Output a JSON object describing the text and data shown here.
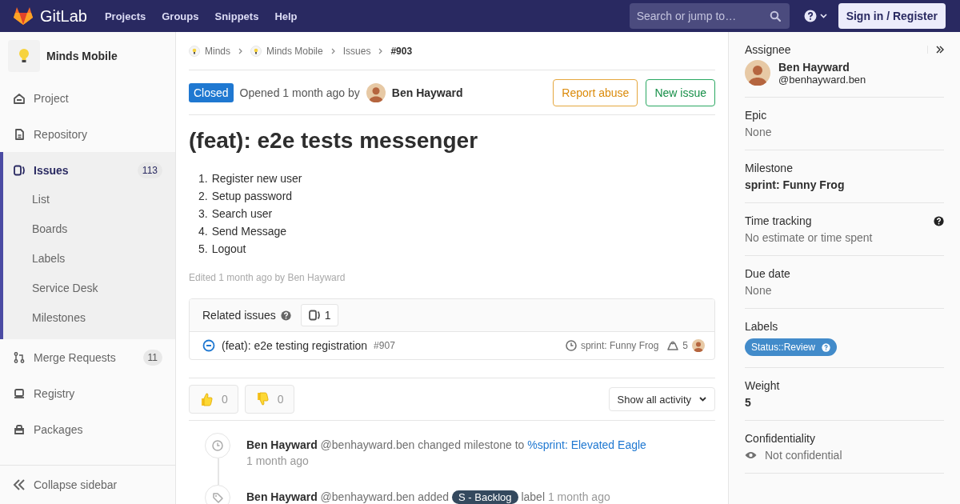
{
  "topbar": {
    "logo": "GitLab",
    "nav": [
      {
        "label": "Projects"
      },
      {
        "label": "Groups"
      },
      {
        "label": "Snippets"
      },
      {
        "label": "Help"
      }
    ],
    "search": {
      "placeholder": "Search or jump to…"
    },
    "sign_in": "Sign in / Register"
  },
  "sidebar": {
    "project": "Minds Mobile",
    "items": [
      {
        "label": "Project",
        "selected": false
      },
      {
        "label": "Repository",
        "selected": false
      },
      {
        "label": "Issues",
        "count": "113",
        "selected": true,
        "children": [
          {
            "label": "List"
          },
          {
            "label": "Boards"
          },
          {
            "label": "Labels"
          },
          {
            "label": "Service Desk"
          },
          {
            "label": "Milestones"
          }
        ]
      },
      {
        "label": "Merge Requests",
        "count": "11",
        "selected": false
      },
      {
        "label": "Registry",
        "selected": false
      },
      {
        "label": "Packages",
        "selected": false
      }
    ],
    "collapse": "Collapse sidebar"
  },
  "breadcrumbs": [
    {
      "label": "Minds",
      "current": false
    },
    {
      "label": "Minds Mobile",
      "current": false
    },
    {
      "label": "Issues",
      "current": false
    },
    {
      "label": "#903",
      "current": true
    }
  ],
  "issue": {
    "status": "Closed",
    "closed": true,
    "opened": "Opened 1 month ago by",
    "author": "Ben Hayward",
    "buttons": [
      {
        "label": "Report abuse",
        "kind": "warning"
      },
      {
        "label": "New issue",
        "kind": "success"
      }
    ],
    "title": "(feat): e2e tests messenger",
    "steps": [
      {
        "number": "1.",
        "text": "Register new user"
      },
      {
        "number": "2.",
        "text": "Setup password"
      },
      {
        "number": "3.",
        "text": "Search user"
      },
      {
        "number": "4.",
        "text": "Send Message"
      },
      {
        "number": "5.",
        "text": "Logout"
      }
    ],
    "edited": "Edited 1 month ago by Ben Hayward"
  },
  "related": {
    "title": "Related issues",
    "count": "1",
    "items": [
      {
        "title": "(feat): e2e testing registration",
        "ref": "#907",
        "closed": true,
        "milestone": "sprint: Funny Frog",
        "weight": "5"
      }
    ]
  },
  "awards": [
    {
      "kind": "thumbsup",
      "count": "0"
    },
    {
      "kind": "thumbsdown",
      "count": "0"
    }
  ],
  "activity_filter": "Show all activity",
  "timeline": [
    {
      "kind": "milestone",
      "author": "Ben Hayward",
      "handle": "@benhayward.ben",
      "action": "changed milestone to",
      "link": "%sprint: Elevated Eagle",
      "time": "1 month ago"
    },
    {
      "kind": "label",
      "author": "Ben Hayward",
      "handle": "@benhayward.ben",
      "action": "added",
      "label": {
        "text": "S - Backlog",
        "color": "#34495e"
      },
      "after": "label",
      "time": "1 month ago"
    }
  ],
  "rightbar": [
    {
      "kind": "assignee",
      "title": "Assignee",
      "name": "Ben Hayward",
      "handle": "@benhayward.ben"
    },
    {
      "kind": "value",
      "title": "Epic",
      "value": "None",
      "bold": false
    },
    {
      "kind": "value",
      "title": "Milestone",
      "value": "sprint: Funny Frog",
      "bold": true
    },
    {
      "kind": "value",
      "title": "Time tracking",
      "value": "No estimate or time spent",
      "bold": false,
      "help": true
    },
    {
      "kind": "value",
      "title": "Due date",
      "value": "None",
      "bold": false
    },
    {
      "kind": "labels",
      "title": "Labels",
      "labels": [
        {
          "text": "Status::Review",
          "color": "#428bca"
        }
      ]
    },
    {
      "kind": "value",
      "title": "Weight",
      "value": "5",
      "bold": true
    },
    {
      "kind": "confidential",
      "title": "Confidentiality",
      "value": "Not confidential"
    }
  ]
}
